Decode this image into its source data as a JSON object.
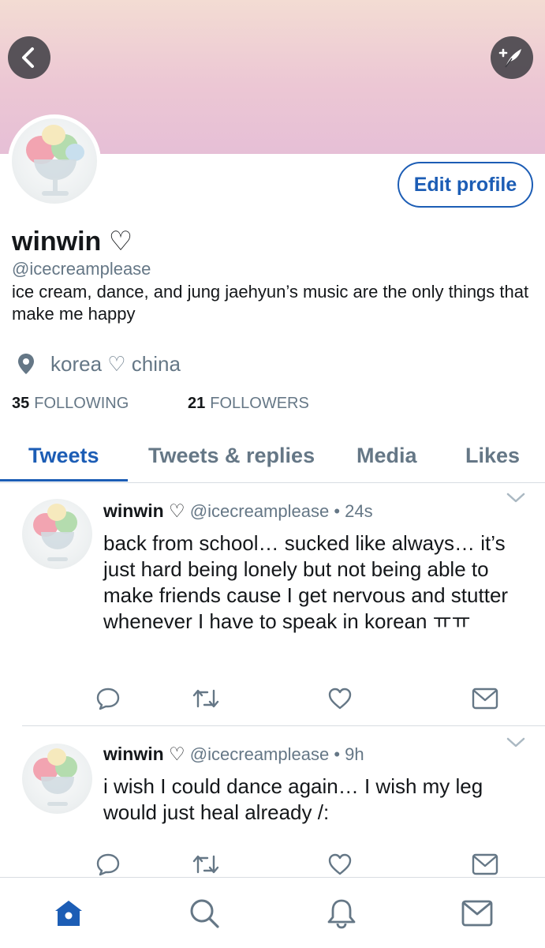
{
  "profile": {
    "display_name": "winwin ♡",
    "handle": "@icecreamplease",
    "bio": "ice cream, dance, and jung jaehyun’s music are the only things that make me happy",
    "location": "korea ♡ china",
    "edit_profile_label": "Edit profile",
    "following_count": "35",
    "following_label": "FOLLOWING",
    "followers_count": "21",
    "followers_label": "FOLLOWERS"
  },
  "tabs": [
    {
      "label": "Tweets",
      "active": true
    },
    {
      "label": "Tweets & replies",
      "active": false
    },
    {
      "label": "Media",
      "active": false
    },
    {
      "label": "Likes",
      "active": false
    }
  ],
  "tweets": [
    {
      "name": "winwin ♡",
      "handle": "@icecreamplease",
      "time": "24s",
      "text": "back from school… sucked like always… it’s just hard being lonely but not being able to make friends cause I get nervous and stutter whenever I have to speak in korean ㅠㅠ"
    },
    {
      "name": "winwin ♡",
      "handle": "@icecreamplease",
      "time": "9h",
      "text": "i wish I could dance again… I wish my leg would just heal already /:"
    }
  ],
  "icons": {
    "back": "back-arrow-icon",
    "compose": "compose-icon",
    "location": "location-pin-icon",
    "reply": "reply-icon",
    "retweet": "retweet-icon",
    "like": "heart-icon",
    "dm": "message-icon",
    "nav": [
      "home-icon",
      "search-icon",
      "notifications-icon",
      "messages-icon"
    ]
  },
  "colors": {
    "accent": "#1c5db5",
    "secondary_text": "#657786",
    "banner_top": "#f3dcd3",
    "banner_bottom": "#e6bfd6"
  }
}
